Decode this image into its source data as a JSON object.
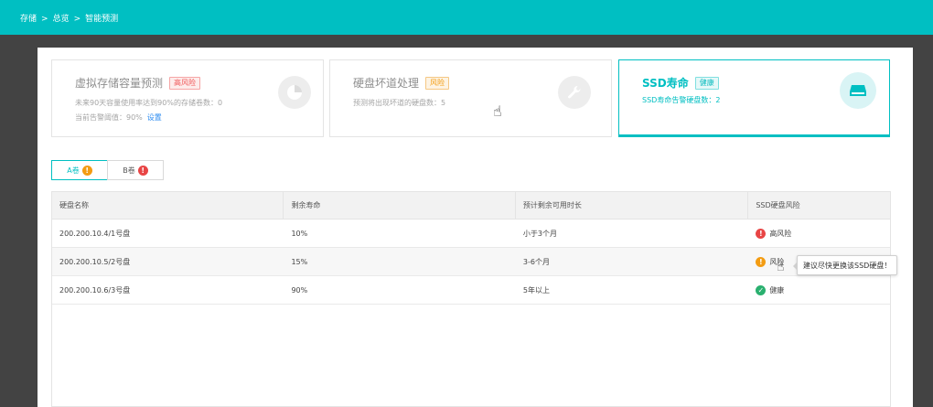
{
  "breadcrumb": [
    "存储",
    "总览",
    "智能预测"
  ],
  "breadcrumb_sep": ">",
  "cards": [
    {
      "title": "虚拟存储容量预测",
      "badge": "高风险",
      "line1": "未来90天容量使用率达到90%的存储卷数：0",
      "line2": "当前告警阈值：90%",
      "link": "设置",
      "icon": "pie-chart-icon"
    },
    {
      "title": "硬盘坏道处理",
      "badge": "风险",
      "line1": "预测将出现坏道的硬盘数：5",
      "icon": "wrench-icon"
    },
    {
      "title": "SSD寿命",
      "badge": "健康",
      "line1": "SSD寿命告警硬盘数：2",
      "icon": "disk-icon"
    }
  ],
  "tabs": [
    {
      "label": "A卷",
      "status": "warning"
    },
    {
      "label": "B卷",
      "status": "danger"
    }
  ],
  "table": {
    "headers": [
      "硬盘名称",
      "剩余寿命",
      "预计剩余可用时长",
      "SSD硬盘风险"
    ],
    "rows": [
      {
        "name": "200.200.10.4/1号盘",
        "life": "10%",
        "remaining": "小于3个月",
        "risk": "高风险"
      },
      {
        "name": "200.200.10.5/2号盘",
        "life": "15%",
        "remaining": "3-6个月",
        "risk": "风险"
      },
      {
        "name": "200.200.10.6/3号盘",
        "life": "90%",
        "remaining": "5年以上",
        "risk": "健康"
      }
    ]
  },
  "tooltip": "建议尽快更换该SSD硬盘！",
  "colors": {
    "accent": "#00bfc2",
    "danger": "#e84545",
    "warning": "#f39c12",
    "success": "#2ab06f"
  }
}
